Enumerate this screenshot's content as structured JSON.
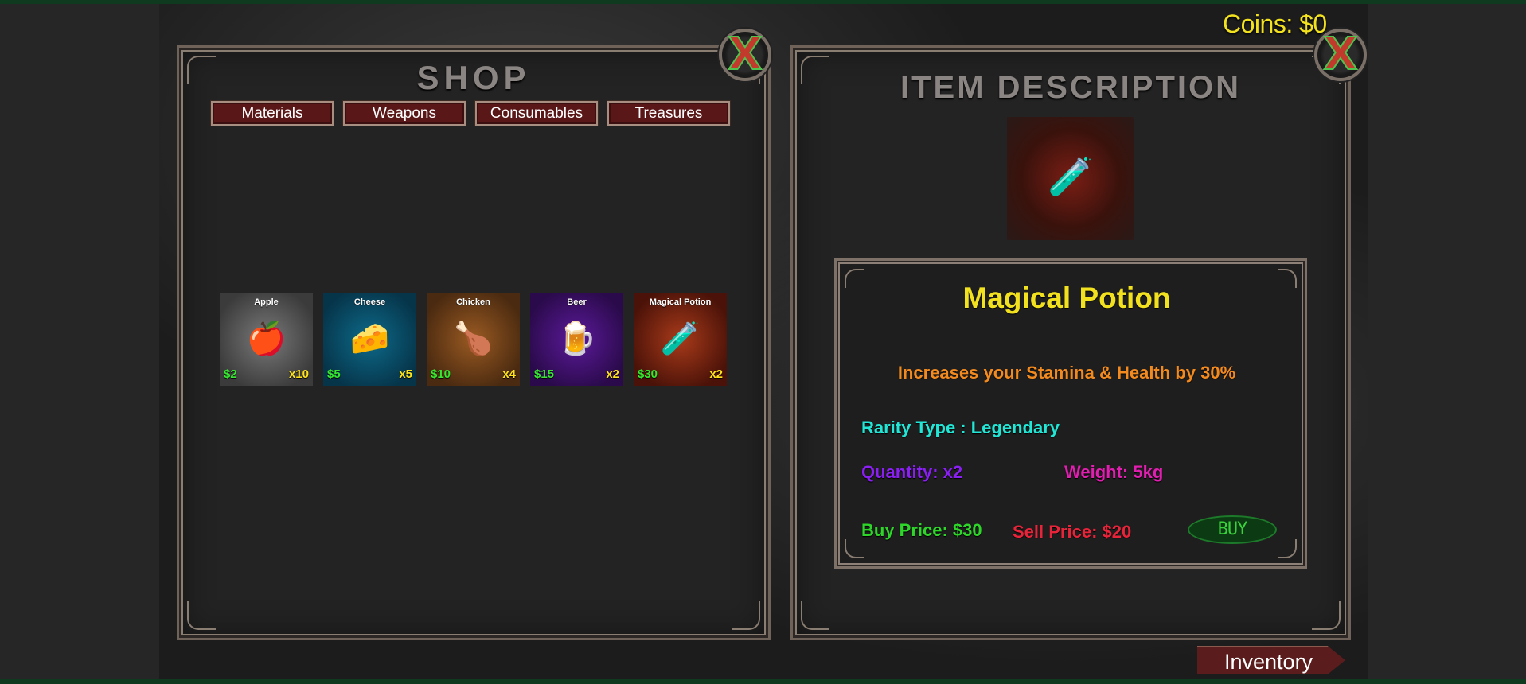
{
  "hud": {
    "coins": "Coins: $0"
  },
  "shop": {
    "title": "SHOP",
    "tabs": [
      {
        "label": "Materials"
      },
      {
        "label": "Weapons"
      },
      {
        "label": "Consumables"
      },
      {
        "label": "Treasures"
      }
    ],
    "items": [
      {
        "name": "Apple",
        "price": "$2",
        "qty": "x10",
        "icon": "apple-icon",
        "glyph": "🍎"
      },
      {
        "name": "Cheese",
        "price": "$5",
        "qty": "x5",
        "icon": "cheese-icon",
        "glyph": "🧀"
      },
      {
        "name": "Chicken",
        "price": "$10",
        "qty": "x4",
        "icon": "chicken-leg-icon",
        "glyph": "🍗"
      },
      {
        "name": "Beer",
        "price": "$15",
        "qty": "x2",
        "icon": "beer-mug-icon",
        "glyph": "🍺"
      },
      {
        "name": "Magical Potion",
        "price": "$30",
        "qty": "x2",
        "icon": "potion-icon",
        "glyph": "🧪"
      }
    ]
  },
  "description": {
    "title": "ITEM DESCRIPTION",
    "preview_icon": "potion-icon",
    "preview_glyph": "🧪",
    "item_name": "Magical Potion",
    "effect": "Increases your Stamina & Health by 30%",
    "rarity": "Rarity Type : Legendary",
    "quantity": "Quantity: x2",
    "weight": "Weight: 5kg",
    "buy_price": "Buy Price: $30",
    "sell_price": "Sell Price: $20",
    "buy_button": "BUY"
  },
  "inventory_button": "Inventory",
  "colors": {
    "coins": "#f2e11f",
    "item_name": "#f2e11f",
    "effect": "#f28a1f",
    "rarity": "#22e6d6",
    "quantity": "#8a1ff2",
    "weight": "#e01fb0",
    "buy_price": "#2fd62a",
    "sell_price": "#e8243a"
  }
}
